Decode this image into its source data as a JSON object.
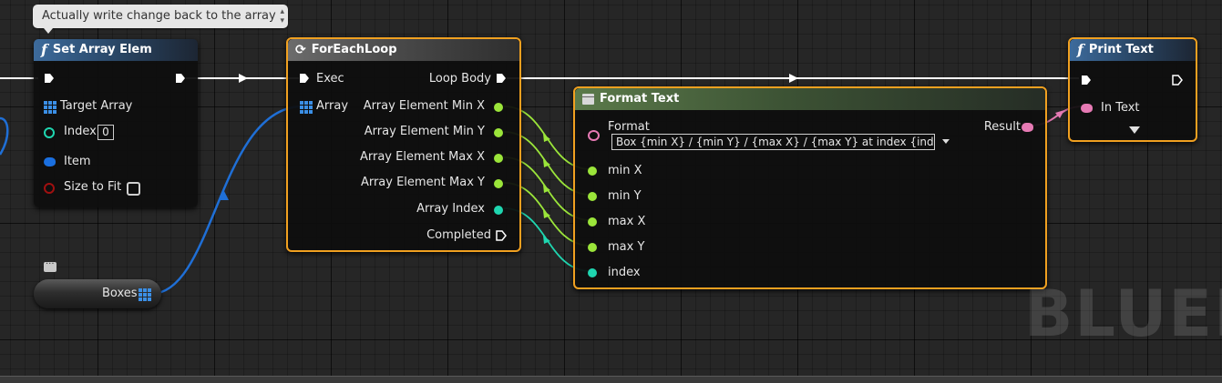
{
  "comment": {
    "text": "Actually write change back to the array"
  },
  "set_array_elem": {
    "title": "Set Array Elem",
    "pins": {
      "target_array": "Target Array",
      "index": "Index",
      "index_value": "0",
      "item": "Item",
      "size_to_fit": "Size to Fit"
    }
  },
  "foreach": {
    "title": "ForEachLoop",
    "pins": {
      "exec": "Exec",
      "array": "Array",
      "loop_body": "Loop Body",
      "min_x": "Array Element Min X",
      "min_y": "Array Element Min Y",
      "max_x": "Array Element Max X",
      "max_y": "Array Element Max Y",
      "array_index": "Array Index",
      "completed": "Completed"
    }
  },
  "format_text": {
    "title": "Format Text",
    "pins": {
      "format": "Format",
      "format_value": "Box {min X} / {min Y} / {max X} / {max Y} at index {index}",
      "result": "Result",
      "min_x": "min X",
      "min_y": "min Y",
      "max_x": "max X",
      "max_y": "max Y",
      "index": "index"
    }
  },
  "print_text": {
    "title": "Print Text",
    "pins": {
      "in_text": "In Text"
    }
  },
  "boxes_var": {
    "label": "Boxes"
  },
  "watermark": "BLUEP",
  "colors": {
    "exec_wire": "#ffffff",
    "array_wire": "#1f6fd6",
    "float_pin": "#9be53a",
    "int_pin": "#1fd6b0",
    "text_pin": "#e67ab4",
    "struct_pin": "#1a6fe0",
    "bool_pin": "#a01010",
    "selected_border": "#f0a020"
  }
}
